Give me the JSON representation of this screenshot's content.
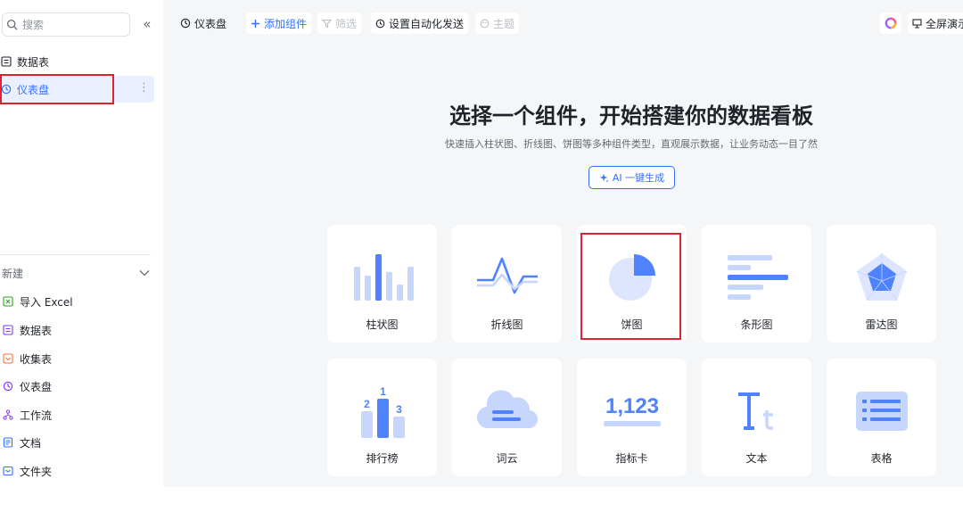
{
  "sidebar": {
    "search_placeholder": "搜索",
    "collapse_icon": "«",
    "items": [
      {
        "label": "数据表",
        "icon": "table-icon"
      },
      {
        "label": "仪表盘",
        "icon": "dashboard-icon",
        "active": true
      }
    ],
    "more_icon": "⋮",
    "new_section": {
      "title": "新建",
      "items": [
        {
          "label": "导入 Excel",
          "icon": "excel-icon",
          "color": "#2ea121"
        },
        {
          "label": "数据表",
          "icon": "table-icon",
          "color": "#7f3bf5"
        },
        {
          "label": "收集表",
          "icon": "form-icon",
          "color": "#f77234"
        },
        {
          "label": "仪表盘",
          "icon": "dashboard-icon",
          "color": "#7f3bf5"
        },
        {
          "label": "工作流",
          "icon": "workflow-icon",
          "color": "#7f3bf5"
        },
        {
          "label": "文档",
          "icon": "doc-icon",
          "color": "#3370ff"
        },
        {
          "label": "文件夹",
          "icon": "folder-icon",
          "color": "#3370ff"
        }
      ]
    }
  },
  "toolbar": {
    "dashboard_label": "仪表盘",
    "add_widget_label": "添加组件",
    "filter_label": "筛选",
    "automation_label": "设置自动化发送",
    "theme_label": "主题",
    "fullscreen_label": "全屏演示"
  },
  "hero": {
    "title": "选择一个组件，开始搭建你的数据看板",
    "subtitle": "快速插入柱状图、折线图、饼图等多种组件类型，直观展示数据，让业务动态一目了然",
    "ai_button": "AI 一键生成"
  },
  "widgets": [
    {
      "label": "柱状图",
      "icon": "bar-chart-icon"
    },
    {
      "label": "折线图",
      "icon": "line-chart-icon"
    },
    {
      "label": "饼图",
      "icon": "pie-chart-icon",
      "highlighted": true
    },
    {
      "label": "条形图",
      "icon": "horizontal-bar-icon"
    },
    {
      "label": "雷达图",
      "icon": "radar-chart-icon"
    },
    {
      "label": "排行榜",
      "icon": "ranking-icon",
      "ranks": [
        "2",
        "1",
        "3"
      ]
    },
    {
      "label": "词云",
      "icon": "word-cloud-icon"
    },
    {
      "label": "指标卡",
      "icon": "metric-card-icon",
      "value": "1,123"
    },
    {
      "label": "文本",
      "icon": "text-icon"
    },
    {
      "label": "表格",
      "icon": "table-widget-icon"
    }
  ],
  "colors": {
    "accent": "#3370ff",
    "highlight_frame": "#e0232e",
    "chart_blue": "#4e83fd",
    "chart_light": "#c6d6fd"
  }
}
